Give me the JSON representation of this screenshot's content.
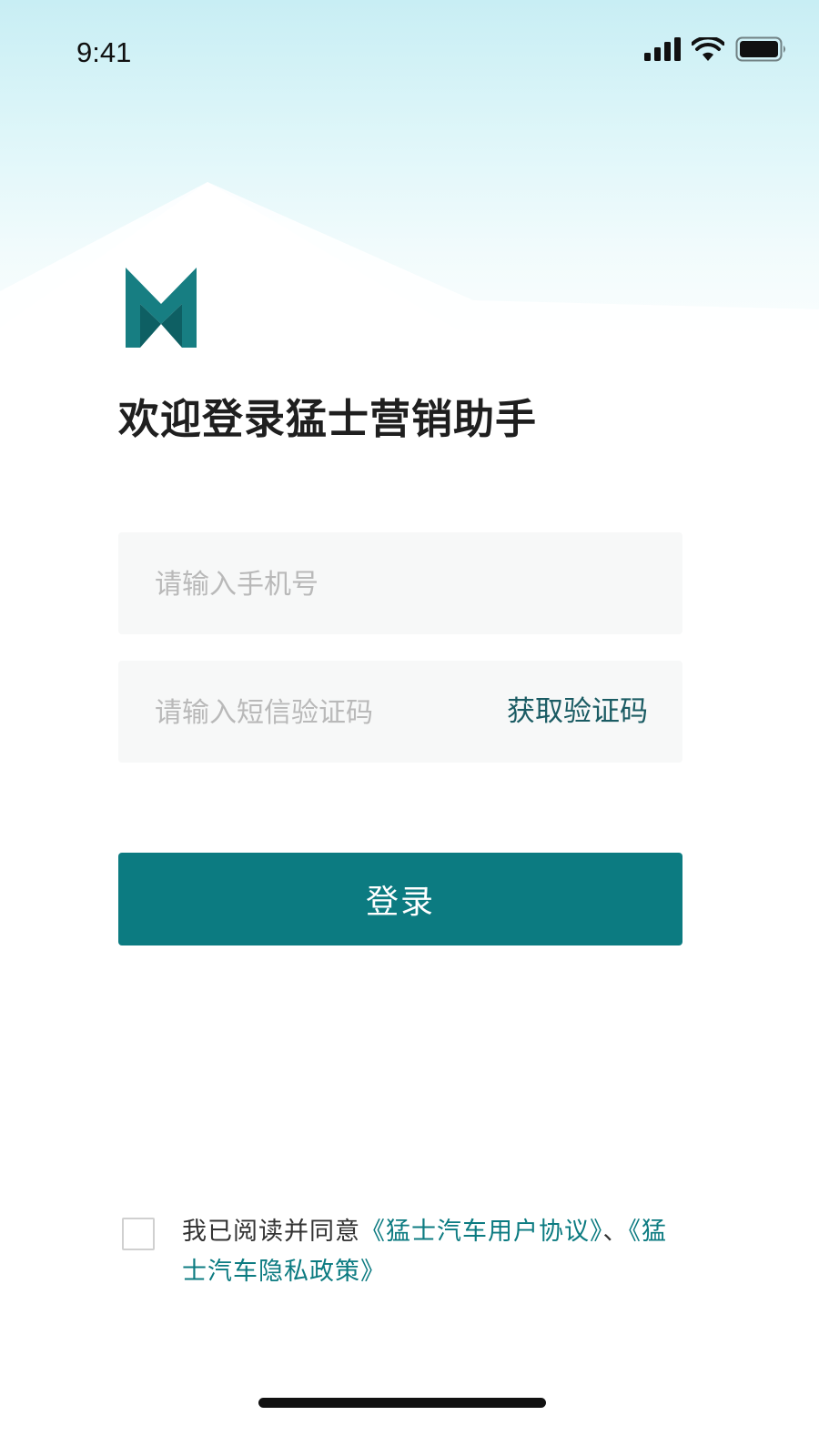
{
  "status_bar": {
    "time": "9:41",
    "icons": [
      "cellular-signal-icon",
      "wifi-icon",
      "battery-icon"
    ]
  },
  "logo": {
    "icon": "brand-logo-icon",
    "color": "#177e82"
  },
  "title": "欢迎登录猛士营销助手",
  "form": {
    "phone": {
      "placeholder": "请输入手机号",
      "value": ""
    },
    "code": {
      "placeholder": "请输入短信验证码",
      "value": ""
    },
    "get_code_label": "获取验证码",
    "login_label": "登录"
  },
  "agreement": {
    "checked": false,
    "prefix": "我已阅读并同意",
    "user_agreement": "《猛士汽车用户协议》",
    "separator": "、",
    "privacy_policy": "《猛士汽车隐私政策》"
  },
  "colors": {
    "accent": "#0c7b81",
    "link": "#0c7b81",
    "placeholder": "#b9b9b9",
    "field_bg": "#f7f8f8"
  }
}
